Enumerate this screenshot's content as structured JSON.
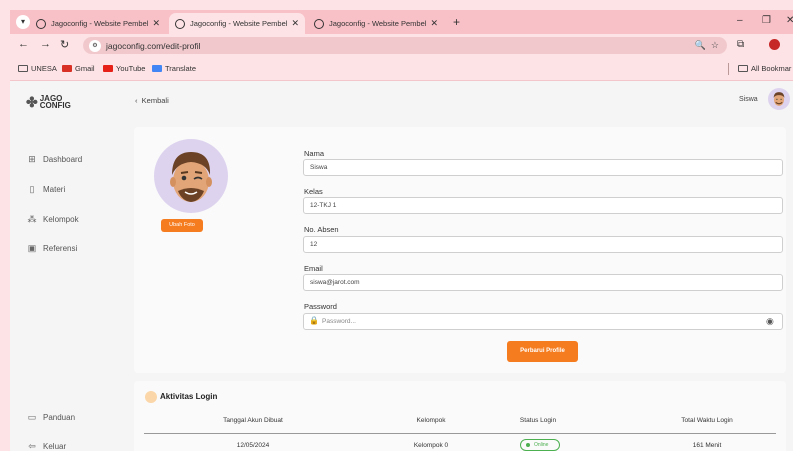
{
  "browser": {
    "tabs": [
      {
        "title": "Jagoconfig - Website Pembelaj"
      },
      {
        "title": "Jagoconfig - Website Pembelaj"
      },
      {
        "title": "Jagoconfig - Website Pembelaj"
      }
    ],
    "url": "jagoconfig.com/edit-profil",
    "bookmarks": [
      "UNESA",
      "Gmail",
      "YouTube",
      "Translate"
    ],
    "all_bookmarks": "All Bookmar"
  },
  "sidebar": {
    "logo": [
      "JAGO",
      "CONFIG"
    ],
    "items": [
      {
        "label": "Dashboard",
        "icon": "grid-icon"
      },
      {
        "label": "Materi",
        "icon": "book-icon"
      },
      {
        "label": "Kelompok",
        "icon": "group-icon"
      },
      {
        "label": "Referensi",
        "icon": "reference-icon"
      },
      {
        "label": "Panduan",
        "icon": "guide-icon"
      },
      {
        "label": "Keluar",
        "icon": "logout-icon"
      }
    ]
  },
  "topbar": {
    "back_label": "Kembali",
    "user_name": "Siswa"
  },
  "profile": {
    "change_photo": "Ubah Foto",
    "fields": {
      "nama": {
        "label": "Nama",
        "value": "Siswa"
      },
      "kelas": {
        "label": "Kelas",
        "value": "12-TKJ 1"
      },
      "absen": {
        "label": "No. Absen",
        "value": "12"
      },
      "email": {
        "label": "Email",
        "value": "siswa@jarot.com"
      },
      "password": {
        "label": "Password",
        "placeholder": "Password..."
      }
    },
    "update_button": "Perbarui Profile"
  },
  "activity": {
    "title": "Aktivitas Login",
    "columns": [
      "Tanggal Akun Dibuat",
      "Kelompok",
      "Status Login",
      "Total Waktu Login"
    ],
    "rows": [
      {
        "date": "12/05/2024",
        "group": "Kelompok 0",
        "status": "Online",
        "total": "161 Menit"
      }
    ]
  },
  "colors": {
    "accent": "#f57c1f",
    "online": "#4caf50",
    "browser_tint": "#f8c0c7"
  }
}
